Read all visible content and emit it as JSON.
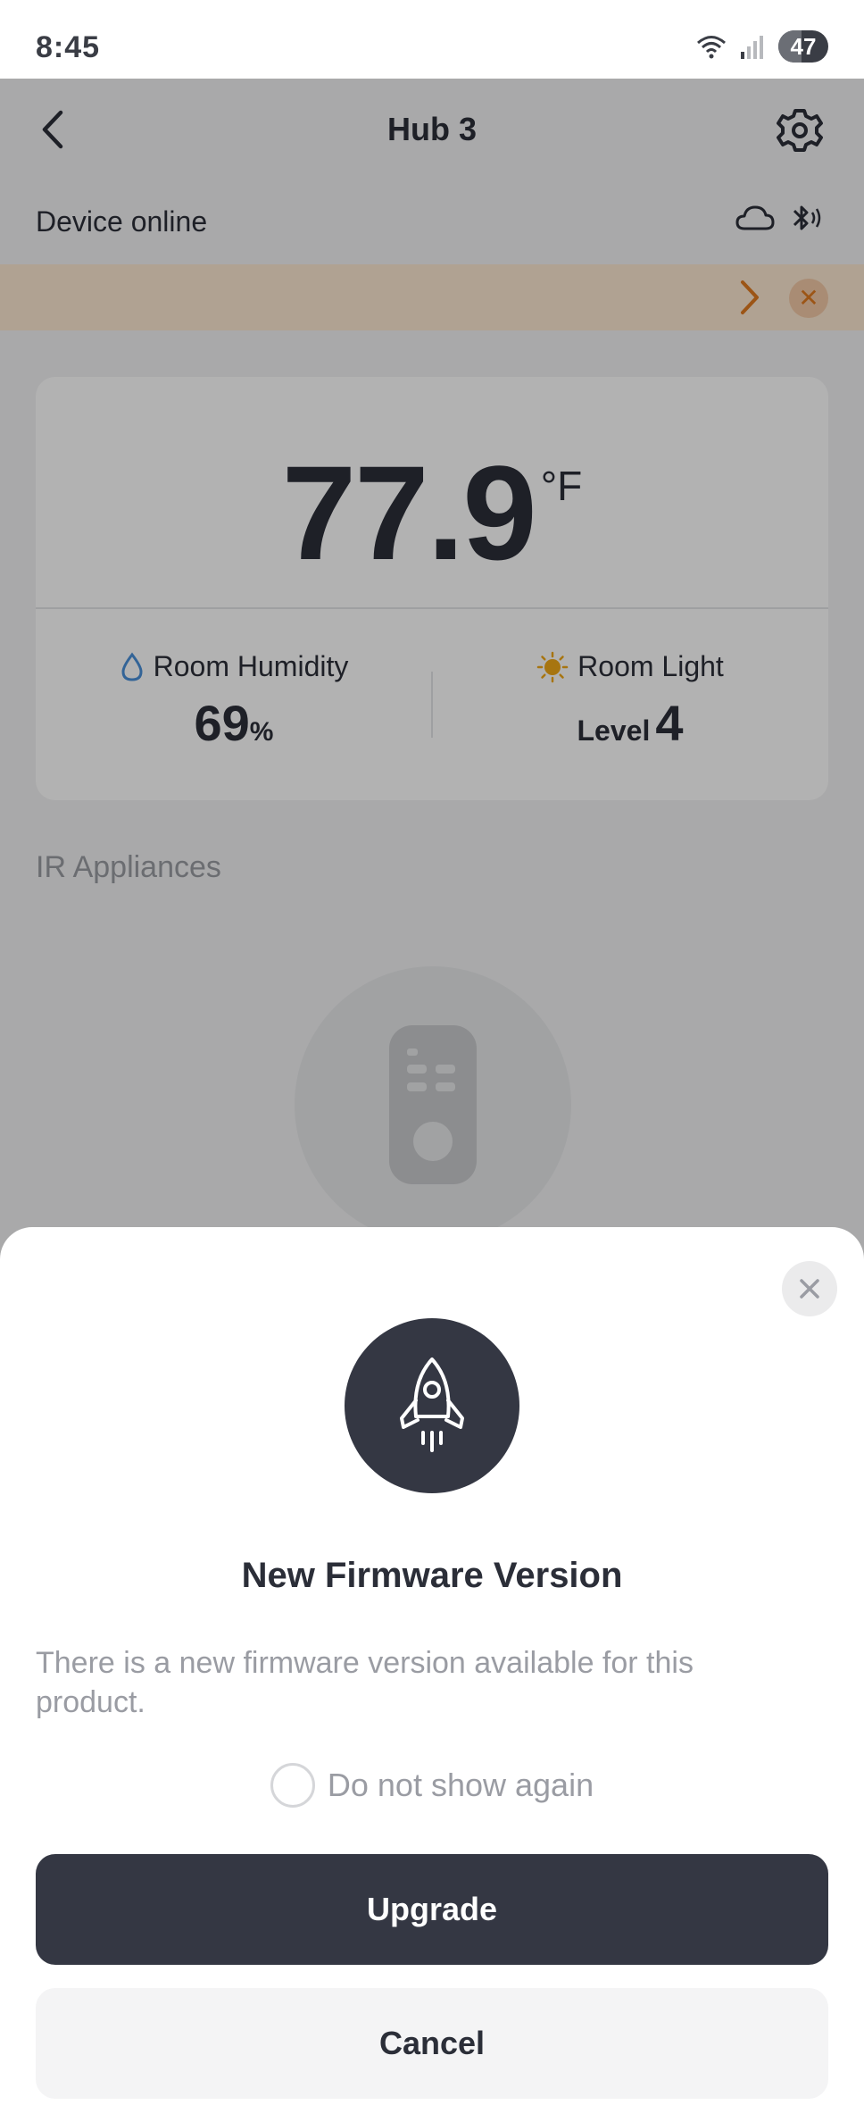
{
  "status_bar": {
    "time": "8:45",
    "battery": "47",
    "battery_level": 0.47
  },
  "header": {
    "title": "Hub 3"
  },
  "device": {
    "status": "Device online"
  },
  "sensor": {
    "temperature": "77.9",
    "temperature_unit": "°F",
    "humidity_label": "Room Humidity",
    "humidity_value": "69",
    "humidity_unit": "%",
    "light_label": "Room Light",
    "light_prefix": "Level",
    "light_value": "4"
  },
  "section": {
    "title": "IR Appliances"
  },
  "dialog": {
    "title": "New Firmware Version",
    "message": "There is a new firmware version available for this product.",
    "checkbox_label": "Do not show again",
    "checkbox_checked": false,
    "upgrade_label": "Upgrade",
    "cancel_label": "Cancel"
  },
  "colors": {
    "primary_dark": "#343743",
    "notice_bg": "#fde8d2",
    "notice_accent": "#e07a20",
    "humidity_icon": "#4a90d9",
    "light_icon": "#f0a818"
  },
  "icons": {
    "back": "chevron-left-icon",
    "settings": "gear-icon",
    "cloud": "cloud-icon",
    "bluetooth": "bluetooth-icon",
    "notice_arrow": "chevron-right-icon",
    "notice_close": "close-icon",
    "humidity": "droplet-icon",
    "light": "sun-icon",
    "remote": "remote-control-icon",
    "sheet_close": "close-icon",
    "rocket": "rocket-icon"
  }
}
